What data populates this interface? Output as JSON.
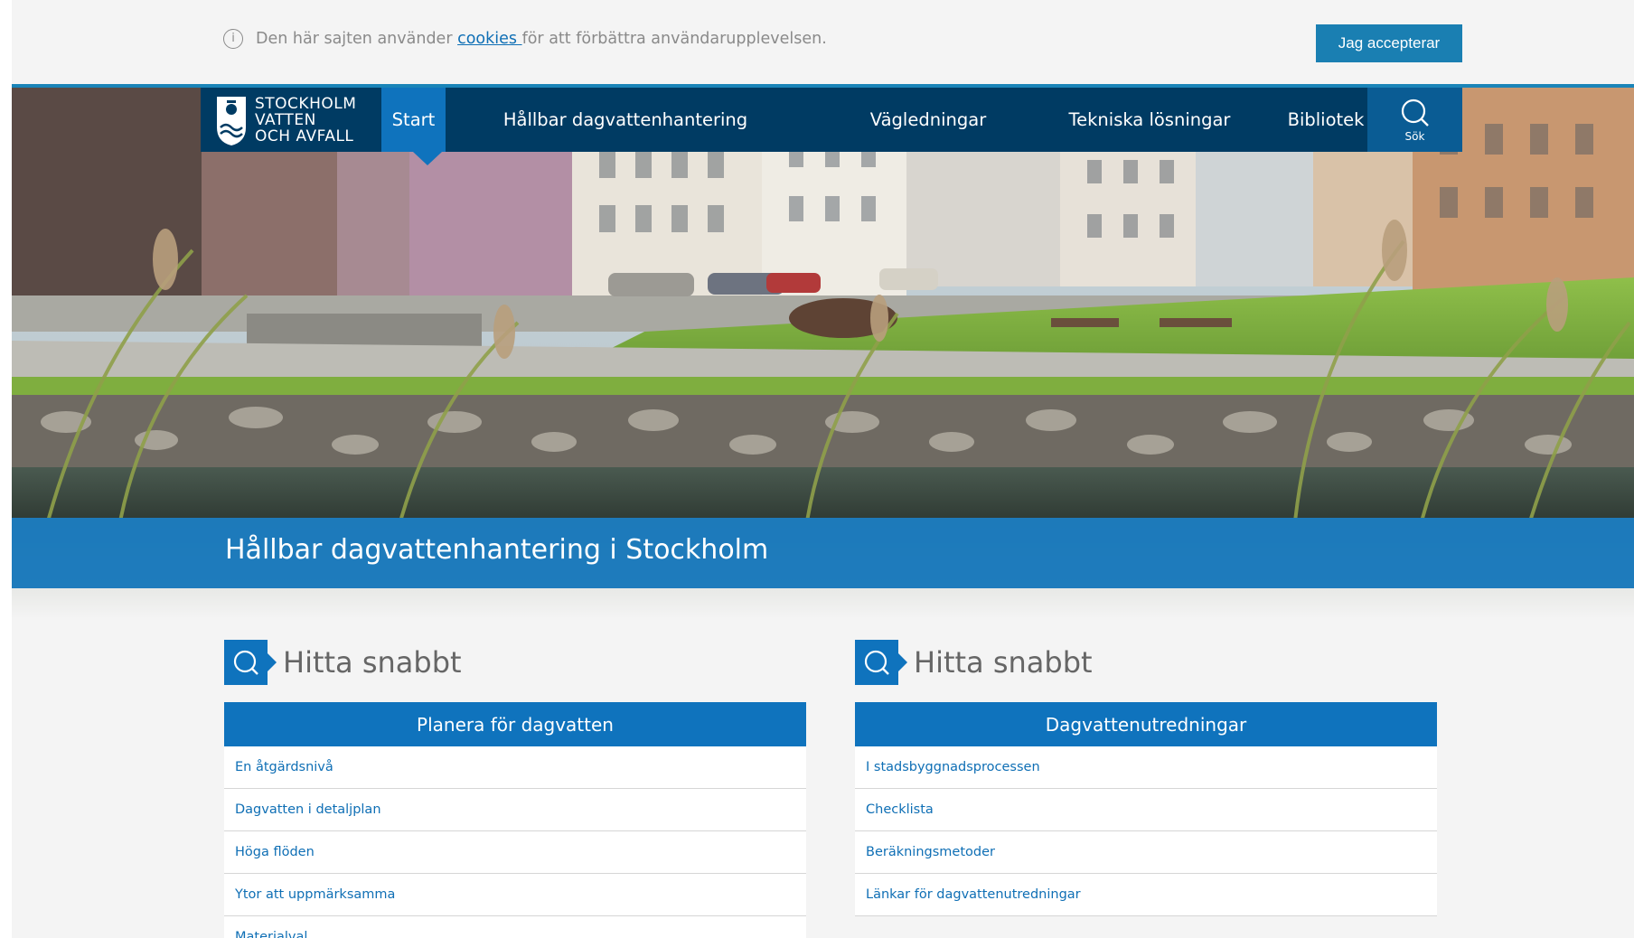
{
  "cookie_bar": {
    "text_before": "Den här sajten använder ",
    "link": "cookies ",
    "text_after": "för att förbättra användarupplevelsen.",
    "accept_label": "Jag accepterar"
  },
  "logo": {
    "line1": "STOCKHOLM",
    "line2": "VATTEN",
    "line3": "OCH AVFALL"
  },
  "nav": {
    "items": [
      "Start",
      "Hållbar dagvattenhantering",
      "Vägledningar",
      "Tekniska lösningar",
      "Bibliotek"
    ],
    "search_label": "Sök"
  },
  "page_title": "Hållbar dagvattenhantering i Stockholm",
  "panels": [
    {
      "title": "Hitta snabbt",
      "category": "Planera för dagvatten",
      "links": [
        "En åtgärdsnivå",
        "Dagvatten i detaljplan",
        "Höga flöden",
        "Ytor att uppmärksamma",
        "Materialval"
      ]
    },
    {
      "title": "Hitta snabbt",
      "category": "Dagvattenutredningar",
      "links": [
        "I stadsbyggnadsprocessen",
        "Checklista",
        "Beräkningsmetoder",
        "Länkar för dagvattenutredningar"
      ]
    }
  ],
  "colors": {
    "primary": "#0f73bd",
    "nav": "#003b63",
    "accent_teal": "#1a7fb2",
    "link": "#0f6fb5"
  },
  "icons": {
    "info": "info-icon",
    "search": "search-icon"
  }
}
